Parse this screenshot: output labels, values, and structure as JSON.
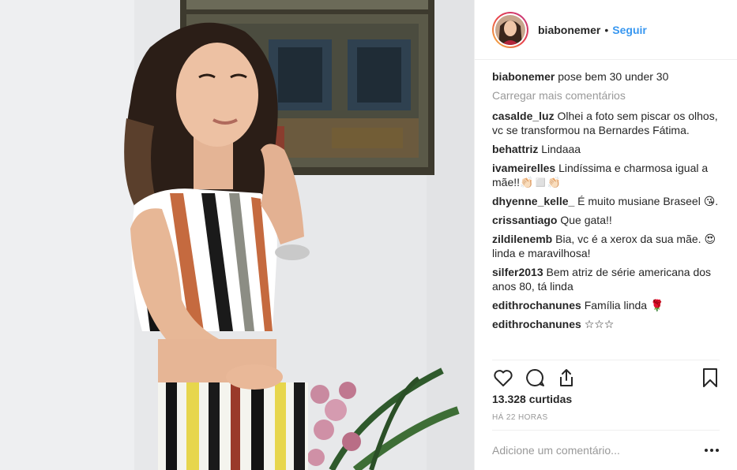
{
  "post": {
    "author": "biabonemer",
    "follow_label": "Seguir",
    "separator": "•",
    "caption_user": "biabonemer",
    "caption_text": "pose bem 30 under 30",
    "load_more": "Carregar mais comentários",
    "likes": "13.328 curtidas",
    "time_ago": "HÁ 22 HORAS",
    "add_comment_placeholder": "Adicione um comentário..."
  },
  "comments": [
    {
      "user": "casalde_luz",
      "text": "Olhei a foto sem piscar os olhos, vc se transformou na Bernardes Fátima."
    },
    {
      "user": "behattriz",
      "text": "Lindaaa"
    },
    {
      "user": "ivameirelles",
      "text": "Lindíssima e charmosa igual a mãe!!👏🏻◻️👏🏻"
    },
    {
      "user": "dhyenne_kelle_",
      "text": "É muito musiane Braseel 😘."
    },
    {
      "user": "crissantiago",
      "text": "Que gata!!"
    },
    {
      "user": "zildilenemb",
      "text": "Bia, vc é a xerox da sua mãe. 😍linda e maravilhosa!"
    },
    {
      "user": "silfer2013",
      "text": "Bem atriz de série americana dos anos 80, tá linda"
    },
    {
      "user": "edithrochanunes",
      "text": "Família linda 🌹"
    },
    {
      "user": "edithrochanunes",
      "text": "☆☆☆"
    }
  ],
  "icons": {
    "like": "heart-icon",
    "comment": "comment-bubble-icon",
    "share": "share-icon",
    "save": "bookmark-icon",
    "more": "more-dots-icon"
  },
  "colors": {
    "accent": "#3897f0",
    "muted": "#999999",
    "border": "#efefef",
    "text": "#262626"
  }
}
